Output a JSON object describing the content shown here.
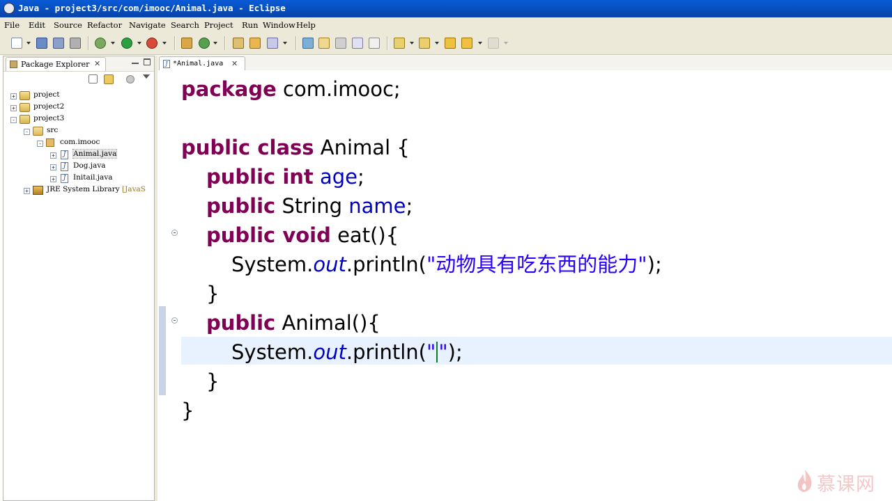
{
  "window": {
    "title": "Java - project3/src/com/imooc/Animal.java - Eclipse"
  },
  "menu": [
    "File",
    "Edit",
    "Source",
    "Refactor",
    "Navigate",
    "Search",
    "Project",
    "Run",
    "Window",
    "Help"
  ],
  "package_explorer": {
    "tab_label": "Package Explorer",
    "tree": [
      {
        "label": "project",
        "icon": "project-folder-icon",
        "expander": "+"
      },
      {
        "label": "project2",
        "icon": "project-folder-icon",
        "expander": "+"
      },
      {
        "label": "project3",
        "icon": "project-folder-icon",
        "expander": "-"
      },
      {
        "label": "src",
        "icon": "source-folder-icon",
        "expander": "-"
      },
      {
        "label": "com.imooc",
        "icon": "package-icon",
        "expander": "-"
      },
      {
        "label": "Animal.java",
        "icon": "java-file-icon",
        "expander": "+",
        "selected": true
      },
      {
        "label": "Dog.java",
        "icon": "java-file-icon",
        "expander": "+"
      },
      {
        "label": "Initail.java",
        "icon": "java-file-icon",
        "expander": "+"
      },
      {
        "label": "JRE System Library",
        "suffix": "[JavaS",
        "icon": "library-icon",
        "expander": "+"
      }
    ]
  },
  "editor": {
    "tab_label": "*Animal.java",
    "code": {
      "l1_kw": "package",
      "l1_rest": " com.imooc;",
      "l2_kw": "public class",
      "l2_rest": " Animal {",
      "l3_kw": "public int",
      "l3_field": "age",
      "l3_end": ";",
      "l4_kw": "public",
      "l4_type": " String ",
      "l4_field": "name",
      "l4_end": ";",
      "l5_kw": "public void",
      "l5_rest": " eat(){",
      "l6_a": "System.",
      "l6_static": "out",
      "l6_b": ".println(",
      "l6_str": "\"动物具有吃东西的能力\"",
      "l6_end": ");",
      "l7": "}",
      "l8_kw": "public",
      "l8_rest": " Animal(){",
      "l9_a": "System.",
      "l9_static": "out",
      "l9_b": ".println(",
      "l9_str1": "\"",
      "l9_str2": "\"",
      "l9_end": ");",
      "l10": "}",
      "l11": "}"
    }
  },
  "watermark": {
    "text": "慕课网"
  },
  "colors": {
    "keyword": "#7f0055",
    "field": "#0000c0",
    "string": "#2a00ff",
    "title_bar": "#0a5bd6",
    "current_line": "#e8f2fe"
  }
}
